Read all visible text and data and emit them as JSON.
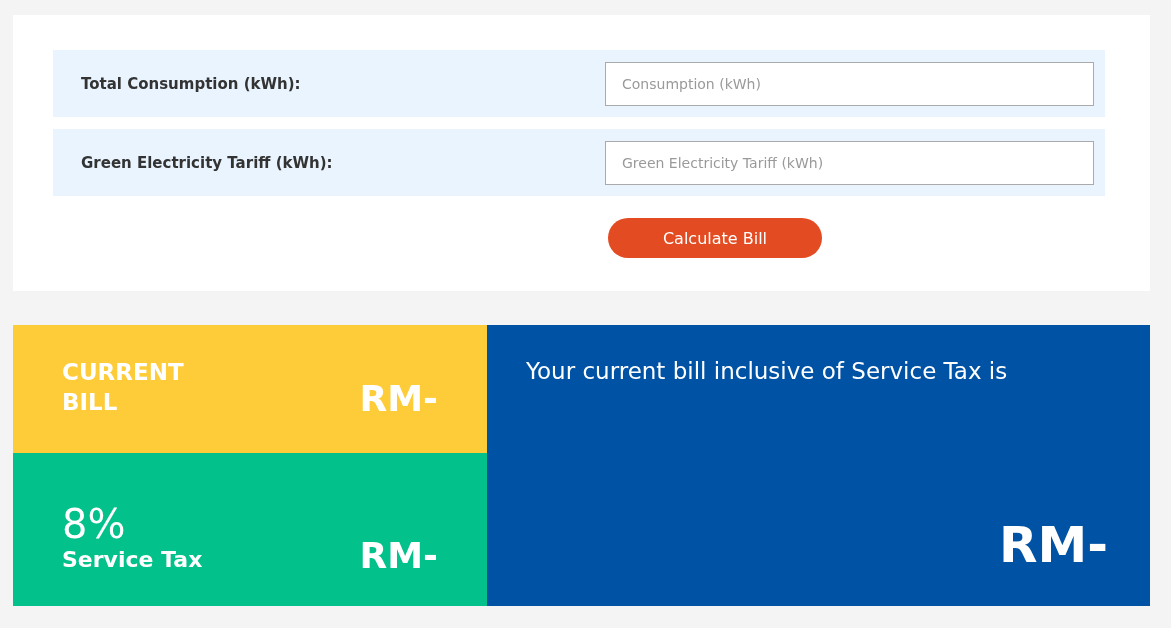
{
  "form": {
    "fields": [
      {
        "label": "Total Consumption (kWh):",
        "placeholder": "Consumption (kWh)"
      },
      {
        "label": "Green Electricity Tariff (kWh):",
        "placeholder": "Green Electricity Tariff (kWh)"
      }
    ],
    "button": "Calculate Bill"
  },
  "results": {
    "current_bill": {
      "label": "CURRENT BILL",
      "amount": "RM-"
    },
    "service_tax": {
      "rate": "8%",
      "label": "Service Tax",
      "amount": "RM-"
    },
    "total": {
      "text": "Your current bill inclusive of Service Tax is",
      "amount": "RM-"
    }
  }
}
